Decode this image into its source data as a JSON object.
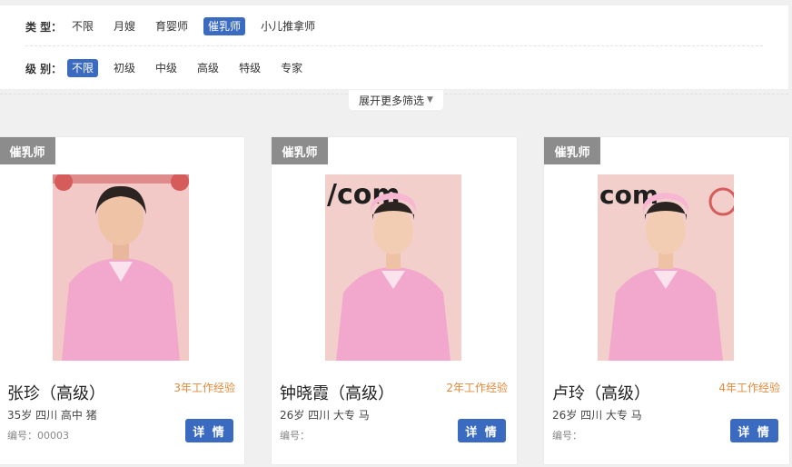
{
  "filters": {
    "type_label": "类 型：",
    "type_options": [
      "不限",
      "月嫂",
      "育婴师",
      "催乳师",
      "小儿推拿师"
    ],
    "level_label": "级 别：",
    "level_options": [
      "不限",
      "初级",
      "中级",
      "高级",
      "特级",
      "专家"
    ]
  },
  "expand_label": "展开更多筛选",
  "colors": {
    "accent": "#3a6bc0",
    "badge": "#8c8c8c",
    "experience": "#e08a3c"
  },
  "cards": [
    {
      "badge": "催乳师",
      "name": "张珍（高级）",
      "experience": "3年工作经验",
      "meta": "35岁  四川  高中  猪",
      "id": "编号：00003",
      "detail": "详 情",
      "photo_text": ""
    },
    {
      "badge": "催乳师",
      "name": "钟晓霞（高级）",
      "experience": "2年工作经验",
      "meta": "26岁  四川  大专  马",
      "id": "编号：",
      "detail": "详 情",
      "photo_text": "/com"
    },
    {
      "badge": "催乳师",
      "name": "卢玲（高级）",
      "experience": "4年工作经验",
      "meta": "26岁  四川  大专  马",
      "id": "编号：",
      "detail": "详 情",
      "photo_text": "com"
    }
  ]
}
